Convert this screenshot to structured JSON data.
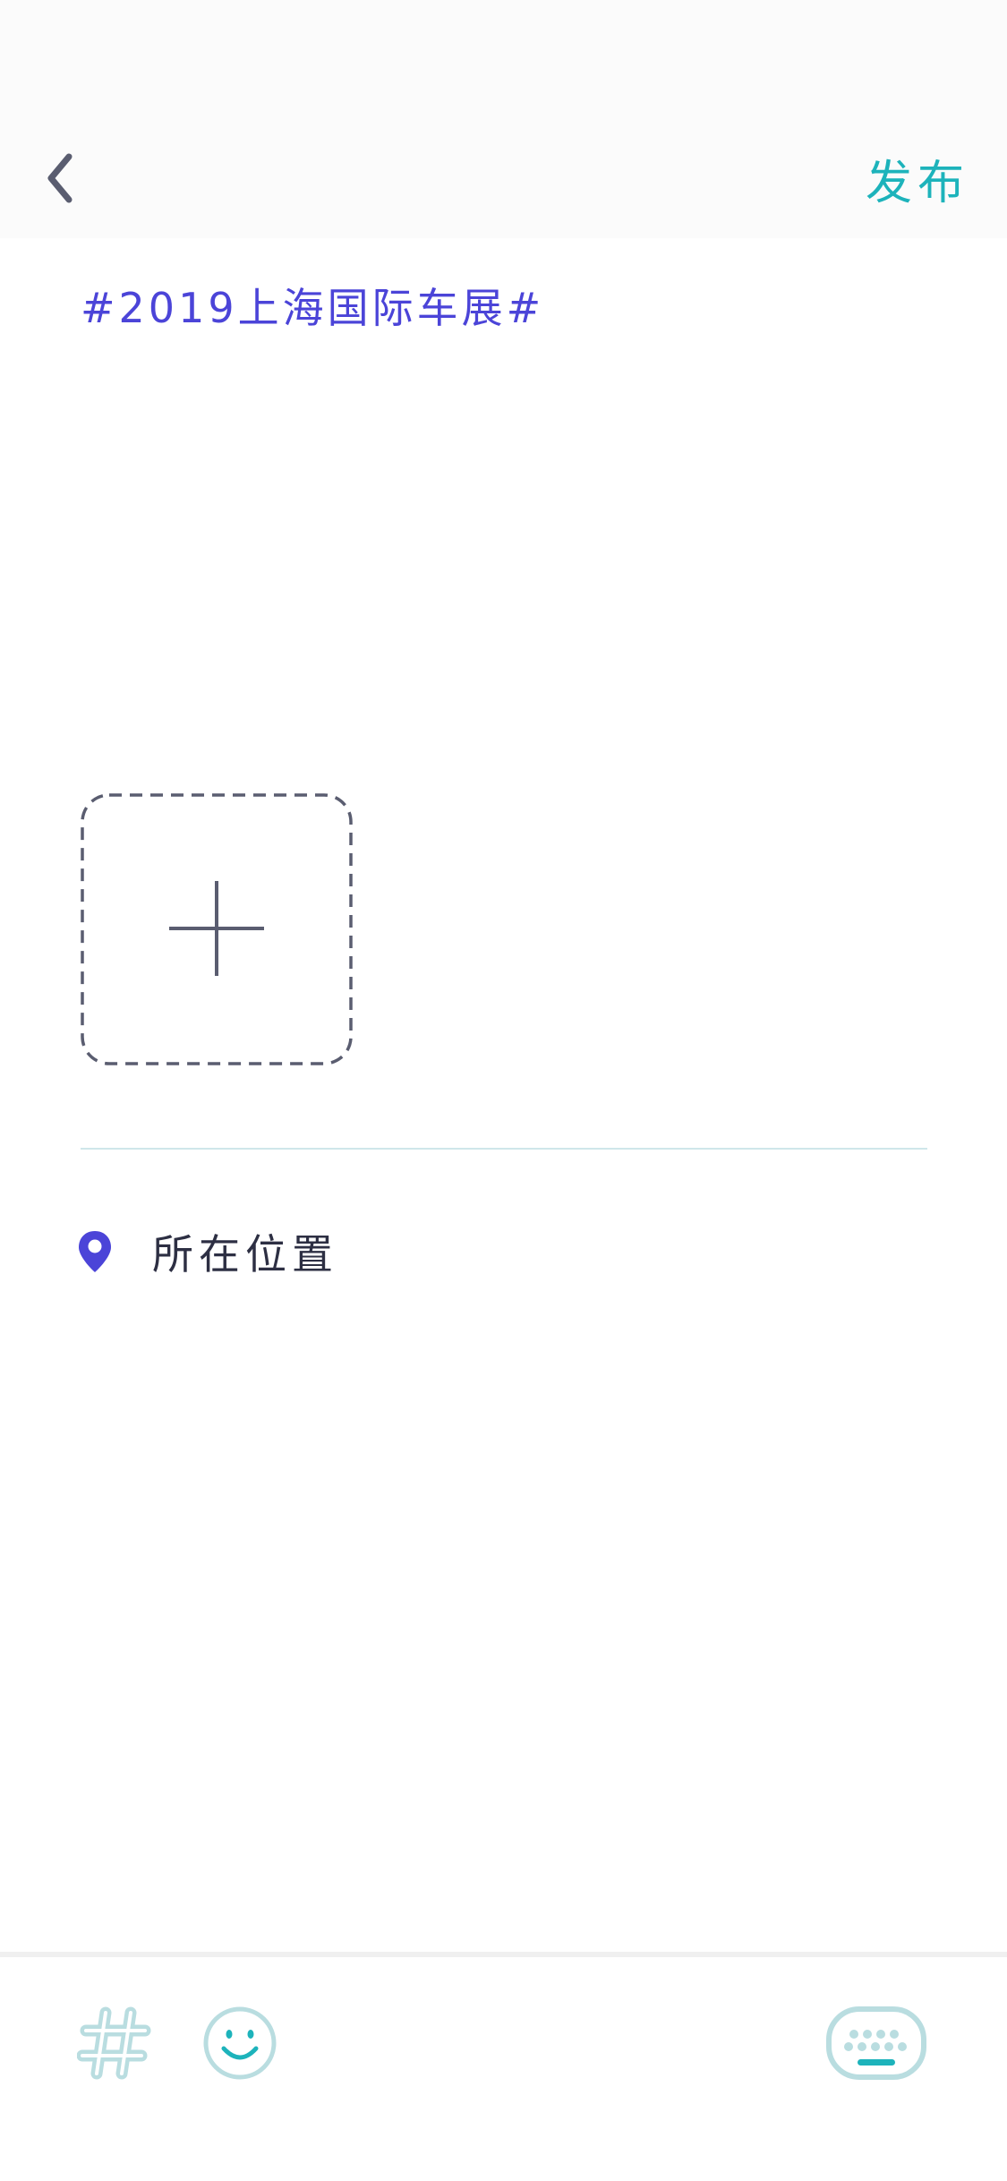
{
  "header": {
    "back_icon": "chevron-left-icon",
    "publish_label": "发布"
  },
  "editor": {
    "topic_text": "#2019上海国际车展#",
    "add_image_icon": "plus-icon"
  },
  "location": {
    "icon": "map-pin-icon",
    "label": "所在位置"
  },
  "toolbar": {
    "items": [
      "hashtag-icon",
      "emoji-icon",
      "keyboard-icon"
    ]
  },
  "colors": {
    "accent": "#1db3bb",
    "topic": "#4b44d8",
    "icon_gray": "#5a5d70",
    "toolbar_icon": "#b9dde0"
  }
}
